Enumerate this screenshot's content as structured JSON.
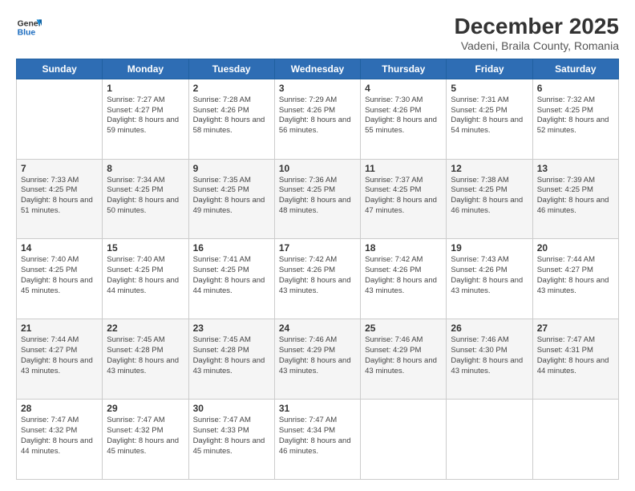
{
  "header": {
    "logo": {
      "general": "General",
      "blue": "Blue"
    },
    "title": "December 2025",
    "location": "Vadeni, Braila County, Romania"
  },
  "weekdays": [
    "Sunday",
    "Monday",
    "Tuesday",
    "Wednesday",
    "Thursday",
    "Friday",
    "Saturday"
  ],
  "weeks": [
    [
      {
        "day": "",
        "sunrise": "",
        "sunset": "",
        "daylight": ""
      },
      {
        "day": "1",
        "sunrise": "Sunrise: 7:27 AM",
        "sunset": "Sunset: 4:27 PM",
        "daylight": "Daylight: 8 hours and 59 minutes."
      },
      {
        "day": "2",
        "sunrise": "Sunrise: 7:28 AM",
        "sunset": "Sunset: 4:26 PM",
        "daylight": "Daylight: 8 hours and 58 minutes."
      },
      {
        "day": "3",
        "sunrise": "Sunrise: 7:29 AM",
        "sunset": "Sunset: 4:26 PM",
        "daylight": "Daylight: 8 hours and 56 minutes."
      },
      {
        "day": "4",
        "sunrise": "Sunrise: 7:30 AM",
        "sunset": "Sunset: 4:26 PM",
        "daylight": "Daylight: 8 hours and 55 minutes."
      },
      {
        "day": "5",
        "sunrise": "Sunrise: 7:31 AM",
        "sunset": "Sunset: 4:25 PM",
        "daylight": "Daylight: 8 hours and 54 minutes."
      },
      {
        "day": "6",
        "sunrise": "Sunrise: 7:32 AM",
        "sunset": "Sunset: 4:25 PM",
        "daylight": "Daylight: 8 hours and 52 minutes."
      }
    ],
    [
      {
        "day": "7",
        "sunrise": "Sunrise: 7:33 AM",
        "sunset": "Sunset: 4:25 PM",
        "daylight": "Daylight: 8 hours and 51 minutes."
      },
      {
        "day": "8",
        "sunrise": "Sunrise: 7:34 AM",
        "sunset": "Sunset: 4:25 PM",
        "daylight": "Daylight: 8 hours and 50 minutes."
      },
      {
        "day": "9",
        "sunrise": "Sunrise: 7:35 AM",
        "sunset": "Sunset: 4:25 PM",
        "daylight": "Daylight: 8 hours and 49 minutes."
      },
      {
        "day": "10",
        "sunrise": "Sunrise: 7:36 AM",
        "sunset": "Sunset: 4:25 PM",
        "daylight": "Daylight: 8 hours and 48 minutes."
      },
      {
        "day": "11",
        "sunrise": "Sunrise: 7:37 AM",
        "sunset": "Sunset: 4:25 PM",
        "daylight": "Daylight: 8 hours and 47 minutes."
      },
      {
        "day": "12",
        "sunrise": "Sunrise: 7:38 AM",
        "sunset": "Sunset: 4:25 PM",
        "daylight": "Daylight: 8 hours and 46 minutes."
      },
      {
        "day": "13",
        "sunrise": "Sunrise: 7:39 AM",
        "sunset": "Sunset: 4:25 PM",
        "daylight": "Daylight: 8 hours and 46 minutes."
      }
    ],
    [
      {
        "day": "14",
        "sunrise": "Sunrise: 7:40 AM",
        "sunset": "Sunset: 4:25 PM",
        "daylight": "Daylight: 8 hours and 45 minutes."
      },
      {
        "day": "15",
        "sunrise": "Sunrise: 7:40 AM",
        "sunset": "Sunset: 4:25 PM",
        "daylight": "Daylight: 8 hours and 44 minutes."
      },
      {
        "day": "16",
        "sunrise": "Sunrise: 7:41 AM",
        "sunset": "Sunset: 4:25 PM",
        "daylight": "Daylight: 8 hours and 44 minutes."
      },
      {
        "day": "17",
        "sunrise": "Sunrise: 7:42 AM",
        "sunset": "Sunset: 4:26 PM",
        "daylight": "Daylight: 8 hours and 43 minutes."
      },
      {
        "day": "18",
        "sunrise": "Sunrise: 7:42 AM",
        "sunset": "Sunset: 4:26 PM",
        "daylight": "Daylight: 8 hours and 43 minutes."
      },
      {
        "day": "19",
        "sunrise": "Sunrise: 7:43 AM",
        "sunset": "Sunset: 4:26 PM",
        "daylight": "Daylight: 8 hours and 43 minutes."
      },
      {
        "day": "20",
        "sunrise": "Sunrise: 7:44 AM",
        "sunset": "Sunset: 4:27 PM",
        "daylight": "Daylight: 8 hours and 43 minutes."
      }
    ],
    [
      {
        "day": "21",
        "sunrise": "Sunrise: 7:44 AM",
        "sunset": "Sunset: 4:27 PM",
        "daylight": "Daylight: 8 hours and 43 minutes."
      },
      {
        "day": "22",
        "sunrise": "Sunrise: 7:45 AM",
        "sunset": "Sunset: 4:28 PM",
        "daylight": "Daylight: 8 hours and 43 minutes."
      },
      {
        "day": "23",
        "sunrise": "Sunrise: 7:45 AM",
        "sunset": "Sunset: 4:28 PM",
        "daylight": "Daylight: 8 hours and 43 minutes."
      },
      {
        "day": "24",
        "sunrise": "Sunrise: 7:46 AM",
        "sunset": "Sunset: 4:29 PM",
        "daylight": "Daylight: 8 hours and 43 minutes."
      },
      {
        "day": "25",
        "sunrise": "Sunrise: 7:46 AM",
        "sunset": "Sunset: 4:29 PM",
        "daylight": "Daylight: 8 hours and 43 minutes."
      },
      {
        "day": "26",
        "sunrise": "Sunrise: 7:46 AM",
        "sunset": "Sunset: 4:30 PM",
        "daylight": "Daylight: 8 hours and 43 minutes."
      },
      {
        "day": "27",
        "sunrise": "Sunrise: 7:47 AM",
        "sunset": "Sunset: 4:31 PM",
        "daylight": "Daylight: 8 hours and 44 minutes."
      }
    ],
    [
      {
        "day": "28",
        "sunrise": "Sunrise: 7:47 AM",
        "sunset": "Sunset: 4:32 PM",
        "daylight": "Daylight: 8 hours and 44 minutes."
      },
      {
        "day": "29",
        "sunrise": "Sunrise: 7:47 AM",
        "sunset": "Sunset: 4:32 PM",
        "daylight": "Daylight: 8 hours and 45 minutes."
      },
      {
        "day": "30",
        "sunrise": "Sunrise: 7:47 AM",
        "sunset": "Sunset: 4:33 PM",
        "daylight": "Daylight: 8 hours and 45 minutes."
      },
      {
        "day": "31",
        "sunrise": "Sunrise: 7:47 AM",
        "sunset": "Sunset: 4:34 PM",
        "daylight": "Daylight: 8 hours and 46 minutes."
      },
      {
        "day": "",
        "sunrise": "",
        "sunset": "",
        "daylight": ""
      },
      {
        "day": "",
        "sunrise": "",
        "sunset": "",
        "daylight": ""
      },
      {
        "day": "",
        "sunrise": "",
        "sunset": "",
        "daylight": ""
      }
    ]
  ]
}
